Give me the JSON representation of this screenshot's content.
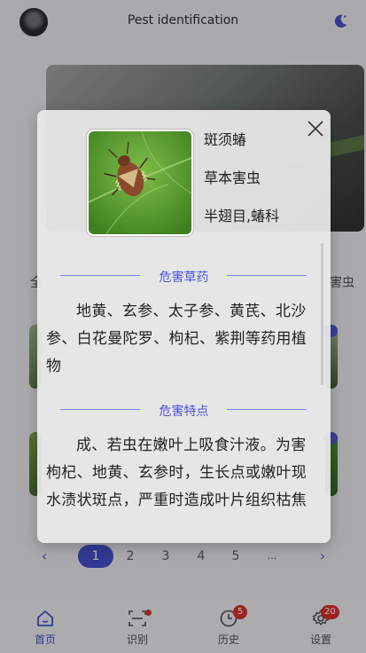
{
  "app": {
    "title": "Pest identification"
  },
  "categories": {
    "left": "全",
    "right": "害虫"
  },
  "pagination": {
    "prev": "‹",
    "pages": [
      "1",
      "2",
      "3",
      "4",
      "5"
    ],
    "active": "1",
    "ellipsis": "...",
    "next": "›"
  },
  "nav": {
    "home": {
      "label": "首页"
    },
    "identify": {
      "label": "识别"
    },
    "history": {
      "label": "历史",
      "badge": "5"
    },
    "settings": {
      "label": "设置",
      "badge": "20"
    }
  },
  "modal": {
    "name": "斑须蝽",
    "type": "草本害虫",
    "order": "半翅目,蝽科",
    "sections": [
      {
        "title": "危害草药",
        "text": "地黄、玄参、太子参、黄芪、北沙参、白花曼陀罗、枸杞、紫荆等药用植物"
      },
      {
        "title": "危害特点",
        "text": "成、若虫在嫩叶上吸食汁液。为害枸杞、地黄、玄参时，生长点或嫩叶现水渍状斑点，严重时造成叶片组织枯焦"
      }
    ]
  },
  "colors": {
    "accent": "#3e46c7",
    "badge": "#d8261c"
  }
}
